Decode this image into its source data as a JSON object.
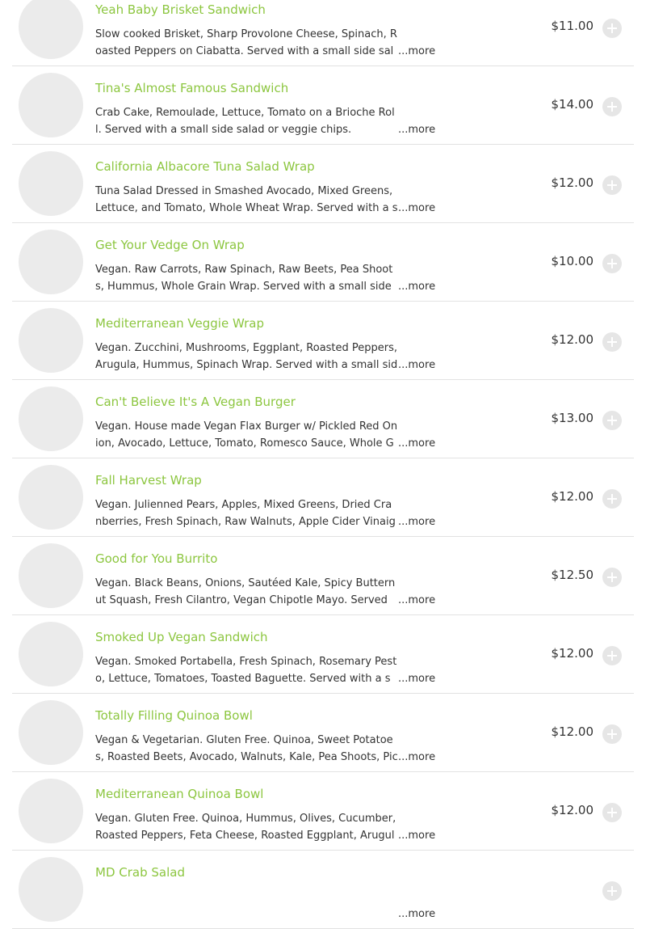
{
  "more_label": "...more",
  "colors": {
    "item_name": "#8cc63f",
    "text": "#333333",
    "divider": "#e2e2e2",
    "thumb_placeholder": "#ebebeb"
  },
  "icons": {
    "add": "plus-circle-icon",
    "thumbnail": "image-placeholder"
  },
  "items": [
    {
      "name": "Yeah Baby Brisket Sandwich",
      "description": "Slow cooked Brisket, Sharp Provolone Cheese, Spinach, Roasted Peppers on Ciabatta. Served with a small side salad or veggie chips.",
      "price": "$11.00"
    },
    {
      "name": "Tina's Almost Famous Sandwich",
      "description": "Crab Cake, Remoulade, Lettuce, Tomato on a Brioche Roll. Served with a small side salad or veggie chips.",
      "price": "$14.00"
    },
    {
      "name": "California Albacore Tuna Salad Wrap",
      "description": "Tuna Salad Dressed in Smashed Avocado, Mixed Greens, Lettuce, and Tomato, Whole Wheat Wrap. Served with a small side salad or veggie chips.",
      "price": "$12.00"
    },
    {
      "name": "Get Your Vedge On Wrap",
      "description": "Vegan. Raw Carrots, Raw Spinach, Raw Beets, Pea Shoots, Hummus, Whole Grain Wrap. Served with a small side salad or veggie chips.",
      "price": "$10.00"
    },
    {
      "name": "Mediterranean Veggie Wrap",
      "description": "Vegan. Zucchini, Mushrooms, Eggplant, Roasted Peppers, Arugula, Hummus, Spinach Wrap. Served with a small side salad or veggie chips.",
      "price": "$12.00"
    },
    {
      "name": "Can't Believe It's A Vegan Burger",
      "description": "Vegan. House made Vegan Flax Burger w/ Pickled Red Onion, Avocado, Lettuce, Tomato, Romesco Sauce, Whole Grain Bun. Served with a small side salad or veggie chips.",
      "price": "$13.00"
    },
    {
      "name": "Fall Harvest Wrap",
      "description": "Vegan. Julienned Pears, Apples, Mixed Greens, Dried Cranberries, Fresh Spinach, Raw Walnuts, Apple Cider Vinaigrette, Spinach Wrap. Served with a small side salad or veggie chips.",
      "price": "$12.00"
    },
    {
      "name": "Good for You Burrito",
      "description": "Vegan. Black Beans, Onions, Sautéed Kale, Spicy Butternut Squash, Fresh Cilantro, Vegan Chipotle Mayo. Served with a small side salad or veggie chips.",
      "price": "$12.50"
    },
    {
      "name": "Smoked Up Vegan Sandwich",
      "description": "Vegan. Smoked Portabella, Fresh Spinach, Rosemary Pesto, Lettuce, Tomatoes, Toasted Baguette. Served with a small side salad or veggie chips.",
      "price": "$12.00"
    },
    {
      "name": "Totally Filling Quinoa Bowl",
      "description": "Vegan & Vegetarian. Gluten Free. Quinoa, Sweet Potatoes, Roasted Beets, Avocado, Walnuts, Kale, Pea Shoots, Pickled Red Onion.",
      "price": "$12.00"
    },
    {
      "name": "Mediterranean Quinoa Bowl",
      "description": "Vegan. Gluten Free. Quinoa, Hummus, Olives, Cucumber, Roasted Peppers, Feta Cheese, Roasted Eggplant, Arugula, Olive Oil.",
      "price": "$12.00"
    },
    {
      "name": "MD Crab Salad",
      "description": "",
      "price": ""
    }
  ]
}
